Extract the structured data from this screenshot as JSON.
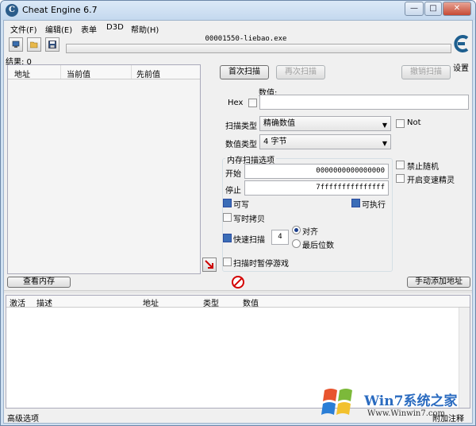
{
  "window": {
    "title": "Cheat Engine 6.7",
    "minimize_glyph": "—",
    "maximize_glyph": "□",
    "close_glyph": "✕"
  },
  "menu": [
    {
      "label": "文件(F)"
    },
    {
      "label": "编辑(E)"
    },
    {
      "label": "表单"
    },
    {
      "label": "D3D"
    },
    {
      "label": "帮助(H)"
    }
  ],
  "toolbar": {
    "icons": [
      "open-process-icon",
      "open-file-icon",
      "save-icon"
    ]
  },
  "process": {
    "name": "00001550-liebao.exe",
    "progress": 0
  },
  "settings_label": "设置",
  "results": {
    "label": "结果: 0",
    "columns": [
      "地址",
      "当前值",
      "先前值"
    ]
  },
  "scan": {
    "first_scan": "首次扫描",
    "next_scan": "再次扫描",
    "undo_scan": "撤销扫描",
    "value_label": "数值:",
    "hex_label": "Hex",
    "value_input": "",
    "scan_type_label": "扫描类型",
    "scan_type_value": "精确数值",
    "value_type_label": "数值类型",
    "value_type_value": "4 字节",
    "not_label": "Not"
  },
  "memory_options": {
    "title": "内存扫描选项",
    "start_label": "开始",
    "start_value": "0000000000000000",
    "stop_label": "停止",
    "stop_value": "7fffffffffffffff",
    "writable": "可写",
    "executable": "可执行",
    "copy_on_write": "写时拷贝",
    "fast_scan": "快速扫描",
    "fast_scan_value": "4",
    "align": "对齐",
    "last_digits": "最后位数",
    "pause_game": "扫描时暂停游戏",
    "disable_random": "禁止随机",
    "speedhack": "开启变速精灵"
  },
  "buttons": {
    "view_memory": "查看内存",
    "add_address": "手动添加地址"
  },
  "address_list": {
    "columns": [
      "激活",
      "描述",
      "地址",
      "类型",
      "数值"
    ]
  },
  "status": {
    "advanced": "高级选项",
    "add_comment": "附加注释"
  },
  "watermark": {
    "brand": "Win7系统之家",
    "url": "Www.Winwin7.com"
  },
  "colors": {
    "progress": "#5bbf4a",
    "stop": "#d40000",
    "watermark": "#2a6bc0"
  }
}
